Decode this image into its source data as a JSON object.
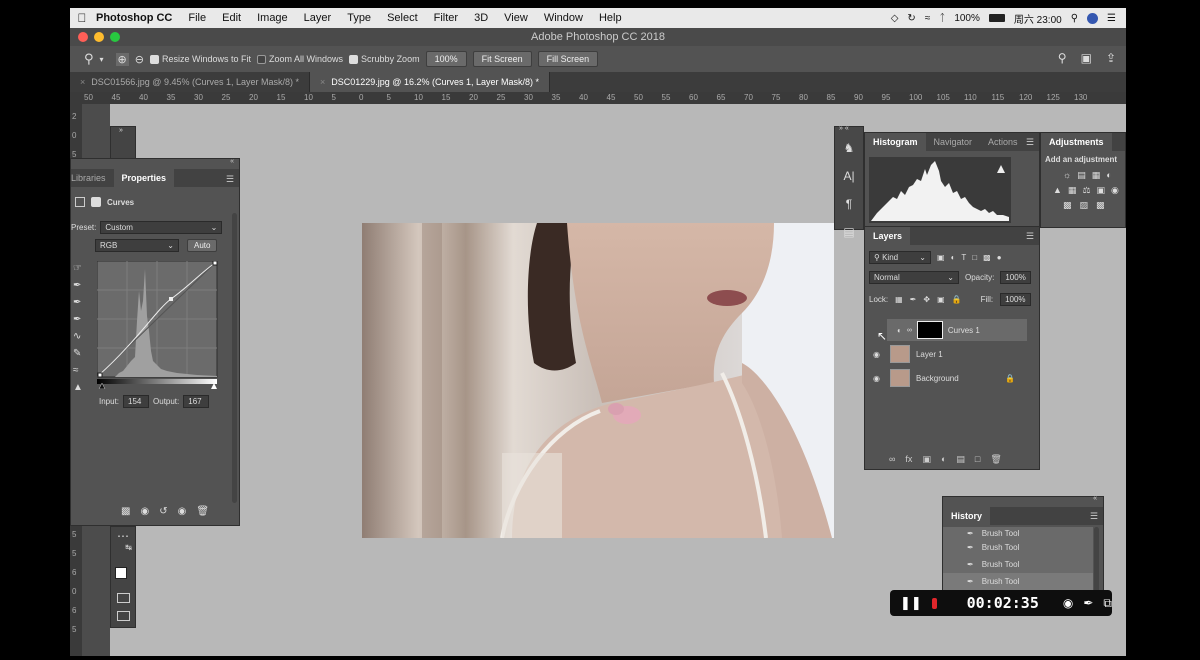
{
  "menubar": {
    "app": "Photoshop CC",
    "items": [
      "File",
      "Edit",
      "Image",
      "Layer",
      "Type",
      "Select",
      "Filter",
      "3D",
      "View",
      "Window",
      "Help"
    ],
    "battery": "100%",
    "clock": "周六 23:00"
  },
  "window": {
    "title": "Adobe Photoshop CC 2018"
  },
  "options": {
    "resize_label": "Resize Windows to Fit",
    "zoom_all_label": "Zoom All Windows",
    "scrubby_label": "Scrubby Zoom",
    "zoom_btn": "100%",
    "fit_btn": "Fit Screen",
    "fill_btn": "Fill Screen"
  },
  "tabs": [
    {
      "label": "DSC01566.jpg @ 9.45% (Curves 1, Layer Mask/8) *"
    },
    {
      "label": "DSC01229.jpg @ 16.2% (Curves 1, Layer Mask/8) *"
    }
  ],
  "ruler_labels": [
    "50",
    "45",
    "40",
    "35",
    "30",
    "25",
    "20",
    "15",
    "10",
    "5",
    "0",
    "5",
    "10",
    "15",
    "20",
    "25",
    "30",
    "35",
    "40",
    "45",
    "50",
    "55",
    "60",
    "65",
    "70",
    "75",
    "80",
    "85",
    "90",
    "95",
    "100",
    "105",
    "110",
    "115",
    "120",
    "125",
    "130"
  ],
  "vruler_labels": [
    "2",
    "0",
    "5",
    "5",
    "1",
    "0",
    "1",
    "5",
    "2",
    "0",
    "2",
    "5",
    "3",
    "0",
    "3",
    "5",
    "4",
    "0",
    "4",
    "5",
    "5",
    "0",
    "5",
    "5",
    "6",
    "0",
    "6",
    "5"
  ],
  "properties": {
    "tab_libraries": "Libraries",
    "tab_properties": "Properties",
    "title": "Curves",
    "preset_label": "Preset:",
    "preset_value": "Custom",
    "channel": "RGB",
    "auto_btn": "Auto",
    "input_label": "Input:",
    "input_value": "154",
    "output_label": "Output:",
    "output_value": "167"
  },
  "histogram": {
    "tab_histogram": "Histogram",
    "tab_navigator": "Navigator",
    "tab_actions": "Actions"
  },
  "adjustments": {
    "tab": "Adjustments",
    "add_label": "Add an adjustment"
  },
  "layers": {
    "tab": "Layers",
    "kind": "Kind",
    "blend": "Normal",
    "opacity_label": "Opacity:",
    "opacity_value": "100%",
    "lock_label": "Lock:",
    "fill_label": "Fill:",
    "fill_value": "100%",
    "items": [
      {
        "name": "Curves 1"
      },
      {
        "name": "Layer 1"
      },
      {
        "name": "Background"
      }
    ]
  },
  "history": {
    "tab": "History",
    "items": [
      "Brush Tool",
      "Brush Tool",
      "Brush Tool",
      "Brush Tool"
    ]
  },
  "recorder": {
    "time": "00:02:35"
  },
  "colors": {
    "accent": "#1473e6",
    "record": "#e0262b",
    "panel": "#535353"
  }
}
